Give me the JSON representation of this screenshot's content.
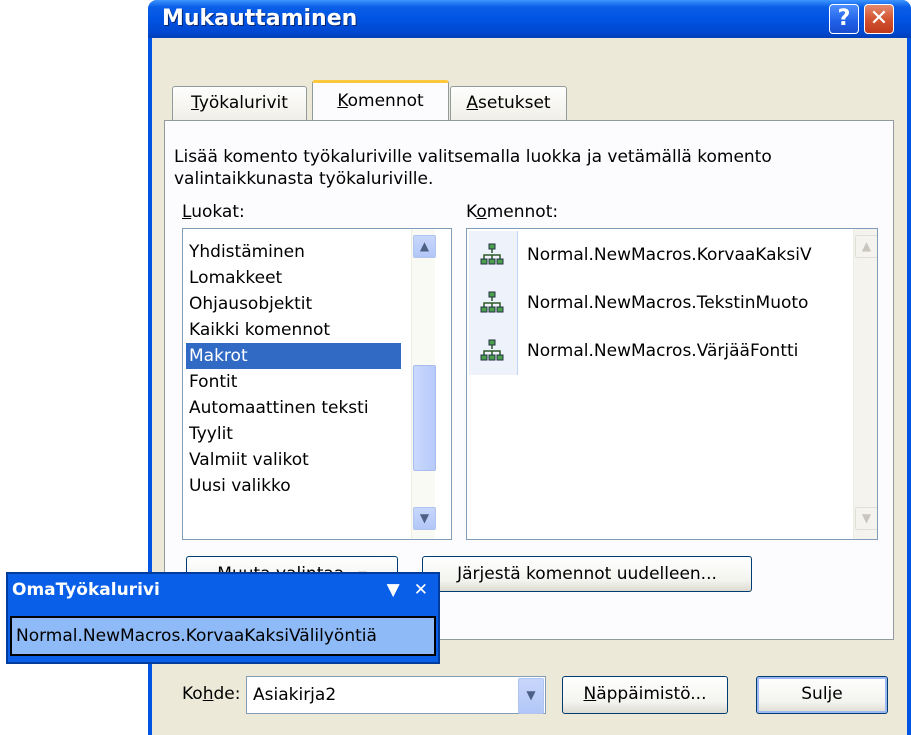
{
  "dialog": {
    "title": "Mukauttaminen",
    "help_label": "?",
    "close_label": "✕"
  },
  "tabs": [
    {
      "label": "Työkalurivit",
      "accesskey": "T",
      "rest": "yökalurivit"
    },
    {
      "label": "Komennot",
      "accesskey": "K",
      "rest": "omennot"
    },
    {
      "label": "Asetukset",
      "accesskey": "A",
      "rest": "setukset"
    }
  ],
  "description": "Lisää komento työkaluriville valitsemalla luokka ja vetämällä komento valintaikkunasta työkaluriville.",
  "categories": {
    "label": "Luokat:",
    "label_key": "L",
    "label_rest": "uokat:",
    "items": [
      "Yhdistäminen",
      "Lomakkeet",
      "Ohjausobjektit",
      "Kaikki komennot",
      "Makrot",
      "Fontit",
      "Automaattinen teksti",
      "Tyylit",
      "Valmiit valikot",
      "Uusi valikko"
    ],
    "selected": "Makrot"
  },
  "commands": {
    "label": "Komennot:",
    "label_key": "o",
    "label_pre": "K",
    "label_rest": "mennot:",
    "items": [
      "Normal.NewMacros.KorvaaKaksiV",
      "Normal.NewMacros.TekstinMuoto",
      "Normal.NewMacros.VärjääFontti"
    ],
    "icon": "macro-icon"
  },
  "buttons": {
    "modify": "Muuta valintaa",
    "modify_key": "M",
    "modify_rest": "uuta valintaa",
    "rearrange": "Järjestä komennot uudelleen...",
    "rearrange_key": "J",
    "rearrange_rest": "ärjestä komennot uudelleen...",
    "keyboard": "Näppäimistö...",
    "keyboard_key": "N",
    "keyboard_rest": "äppäimistö...",
    "close": "Sulje"
  },
  "target": {
    "label": "Kohde:",
    "label_pre": "Ko",
    "label_key": "h",
    "label_rest": "de:",
    "value": "Asiakirja2"
  },
  "toolbar": {
    "title": "OmaTyökalurivi",
    "dropdown_glyph": "▼",
    "close_glyph": "✕",
    "item": "Normal.NewMacros.KorvaaKaksiVälilyöntiä"
  }
}
